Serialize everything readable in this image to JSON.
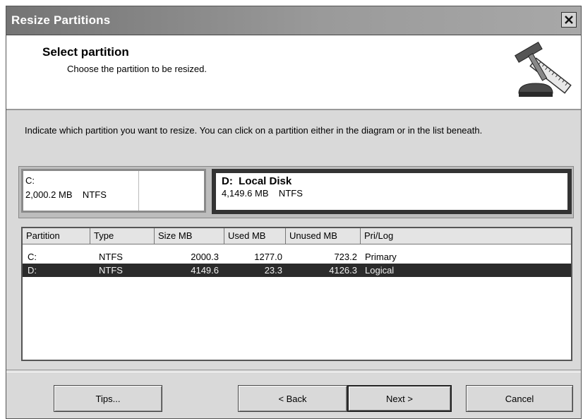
{
  "window": {
    "title": "Resize Partitions"
  },
  "header": {
    "title": "Select partition",
    "subtitle": "Choose the partition to be resized."
  },
  "instruction": "Indicate which partition you want to resize. You can click on a partition either in the diagram or in the list beneath.",
  "diagram": {
    "partitions": [
      {
        "letter": "C:",
        "info": "2,000.2 MB    NTFS"
      },
      {
        "letter": "D:  Local Disk",
        "info": "4,149.6 MB    NTFS"
      }
    ]
  },
  "table": {
    "columns": [
      "Partition",
      "Type",
      "Size MB",
      "Used MB",
      "Unused MB",
      "Pri/Log"
    ],
    "rows": [
      [
        "C:",
        "NTFS",
        "2000.3",
        "1277.0",
        "723.2",
        "Primary"
      ],
      [
        "D:",
        "NTFS",
        "4149.6",
        "23.3",
        "4126.3",
        "Logical"
      ]
    ],
    "selected_row": 1
  },
  "buttons": {
    "tips": "Tips...",
    "back": "< Back",
    "next": "Next >",
    "cancel": "Cancel"
  },
  "icons": {
    "close": "close-icon",
    "wizard": "hammer-ruler-icon"
  }
}
